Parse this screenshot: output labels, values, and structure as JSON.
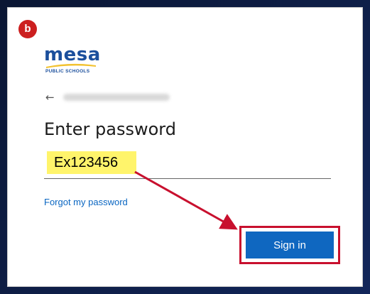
{
  "step": {
    "label": "b"
  },
  "logo": {
    "word": "mesa",
    "subtitle": "PUBLIC SCHOOLS",
    "swoosh_color": "#f2c230",
    "brand_color": "#1b4f9c"
  },
  "back": {
    "icon": "back-arrow-icon",
    "glyph": "←"
  },
  "heading": "Enter password",
  "password": {
    "value": "Ex123456",
    "highlight_color": "#fff46b"
  },
  "forgot": {
    "label": "Forgot my password"
  },
  "sign_in": {
    "label": "Sign in",
    "color": "#0f67c0",
    "annotation_color": "#c8102e"
  }
}
